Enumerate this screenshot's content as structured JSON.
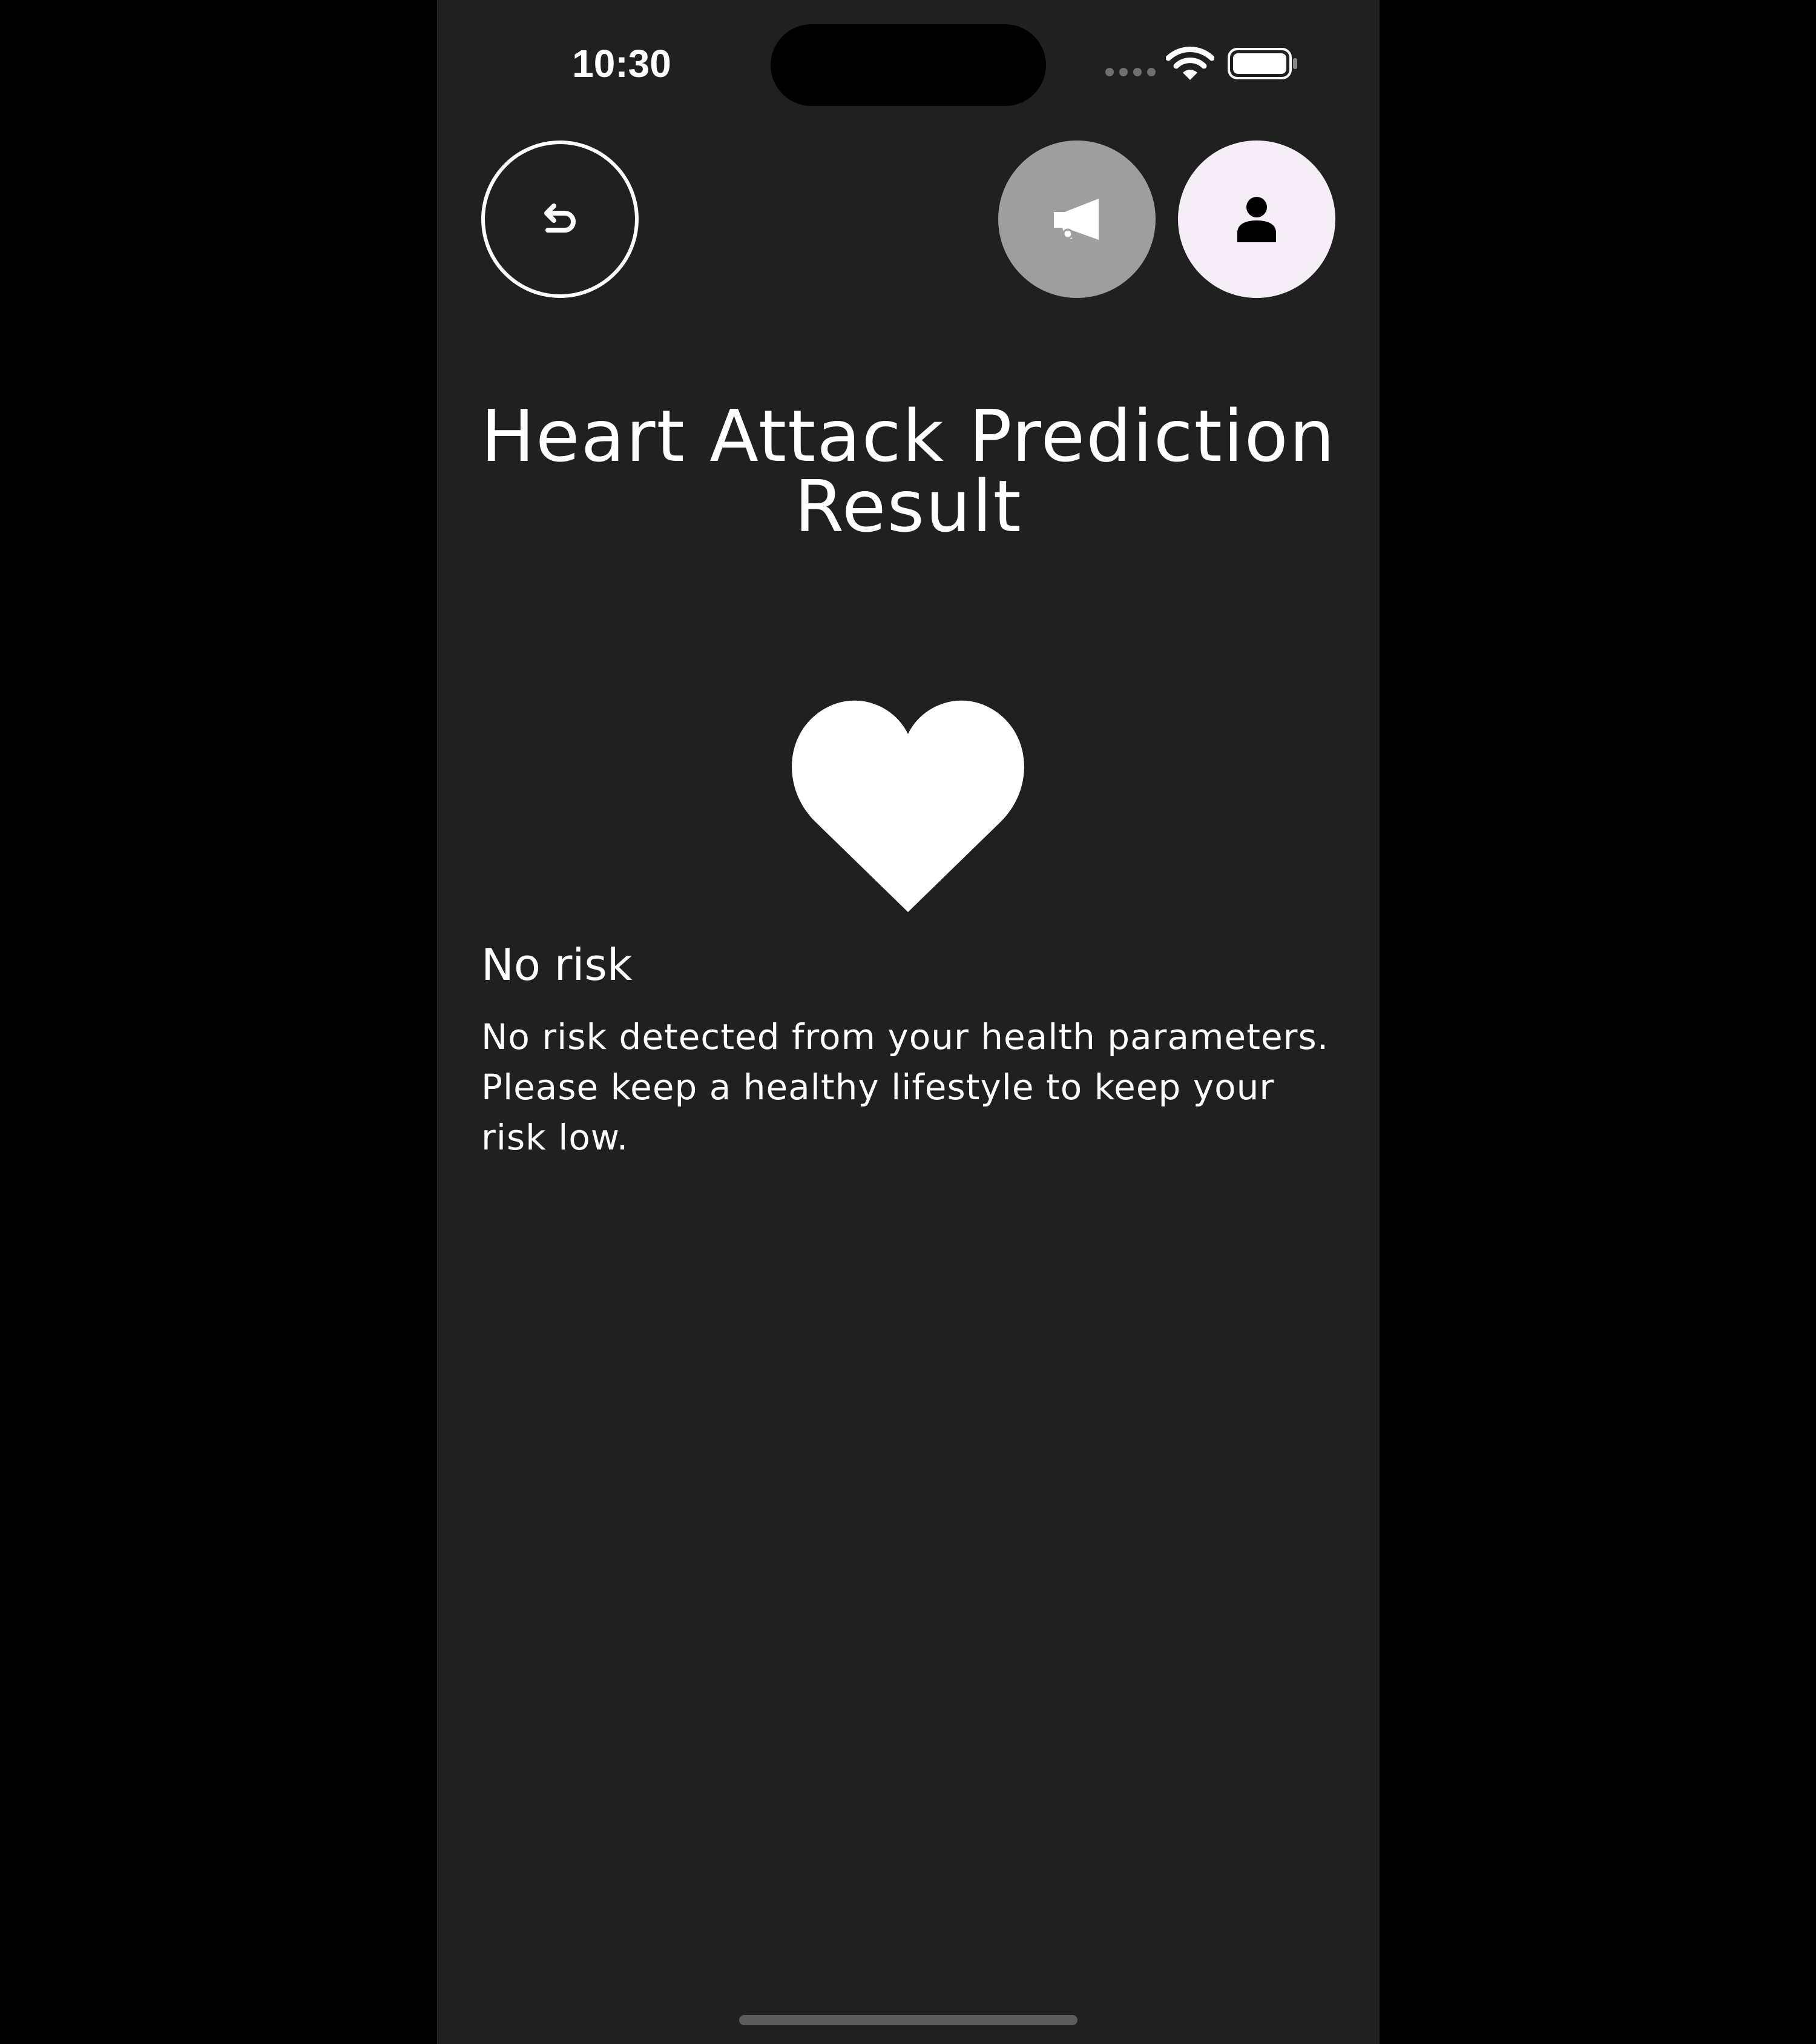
{
  "status_bar": {
    "time": "10:30"
  },
  "header": {
    "back_icon": "undo-arrow-icon",
    "announce_icon": "megaphone-icon",
    "profile_icon": "person-icon"
  },
  "main": {
    "title": "Heart Attack Prediction Result",
    "result_icon": "heart-icon",
    "risk_label": "No risk",
    "risk_description": "No risk detected from your health parameters. Please keep a healthy lifestyle to keep your risk low."
  },
  "colors": {
    "background": "#202020",
    "text": "#ffffff",
    "announce_button": "#9e9e9e",
    "profile_button": "#f5eef6"
  }
}
